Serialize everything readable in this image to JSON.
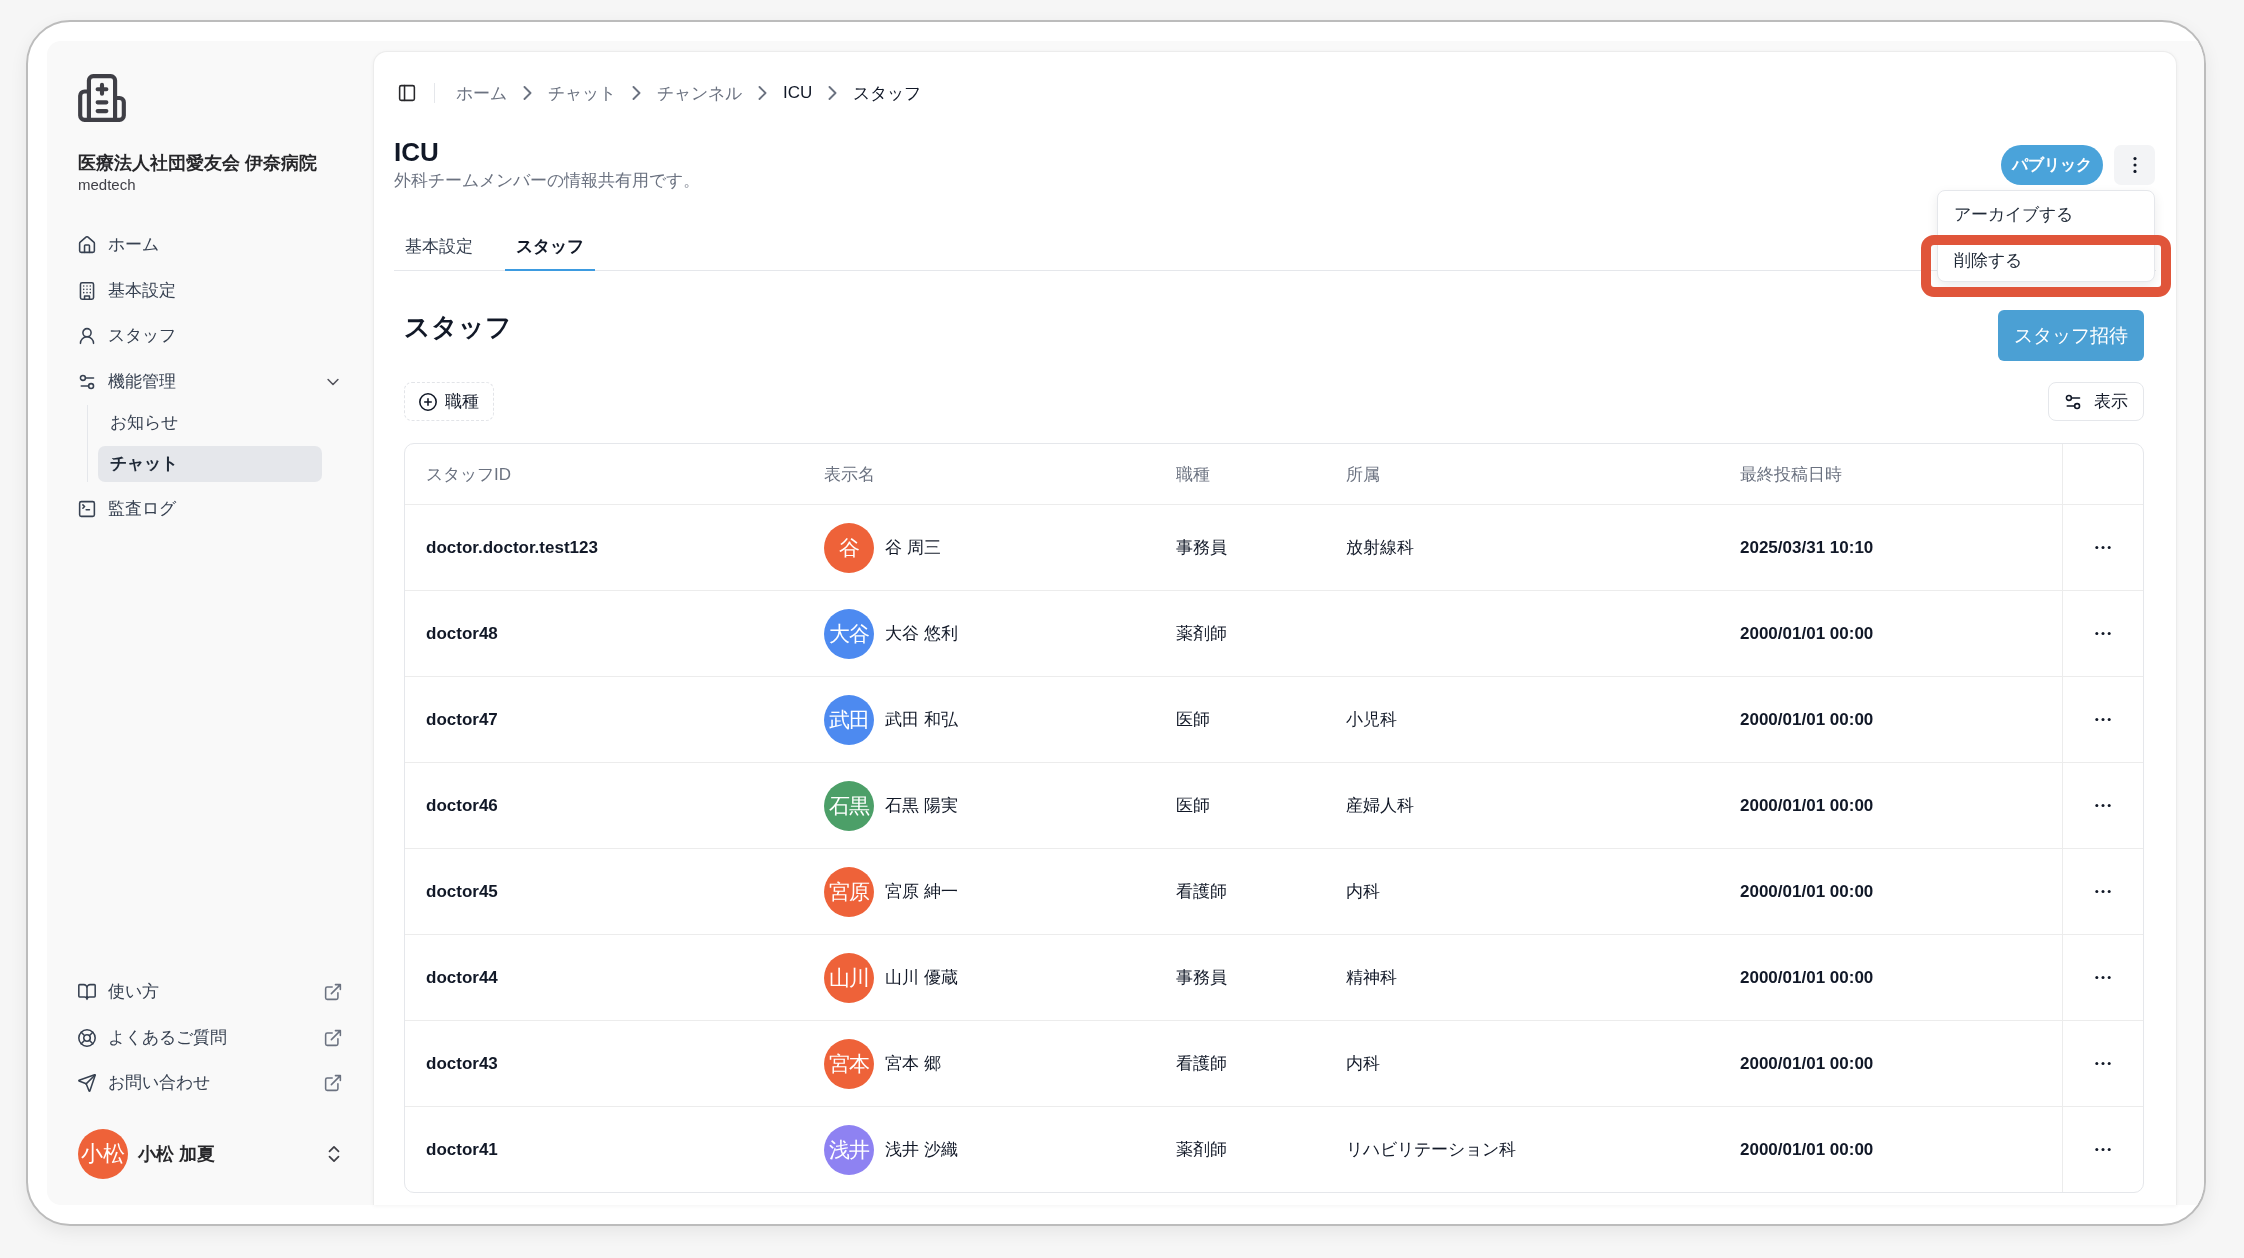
{
  "sidebar": {
    "organization": {
      "name": "医療法人社団愛友会 伊奈病院",
      "subtitle": "medtech"
    },
    "nav": [
      {
        "kind": "link",
        "label": "ホーム",
        "selected": false
      },
      {
        "kind": "link",
        "label": "基本設定",
        "selected": false
      },
      {
        "kind": "link",
        "label": "スタッフ",
        "selected": false
      },
      {
        "kind": "group",
        "label": "機能管理",
        "selected": false,
        "expanded": true,
        "children": [
          {
            "label": "お知らせ",
            "selected": false
          },
          {
            "label": "チャット",
            "selected": true
          }
        ]
      },
      {
        "kind": "link",
        "label": "監査ログ",
        "selected": false
      }
    ],
    "external_links": [
      {
        "label": "使い方"
      },
      {
        "label": "よくあるご質問"
      },
      {
        "label": "お問い合わせ"
      }
    ],
    "user": {
      "avatar": "小松",
      "name": "小松 加夏"
    }
  },
  "breadcrumb": [
    {
      "kind": "link",
      "label": "ホーム"
    },
    {
      "kind": "link",
      "label": "チャット"
    },
    {
      "kind": "link",
      "label": "チャンネル"
    },
    {
      "kind": "current",
      "label": "ICU"
    },
    {
      "kind": "current",
      "label": "スタッフ"
    }
  ],
  "header": {
    "title": "ICU",
    "description": "外科チームメンバーの情報共有用です。",
    "badge": "パブリック",
    "menu_open": true,
    "menu": [
      {
        "label": "アーカイブする",
        "highlighted": false
      },
      {
        "label": "削除する",
        "highlighted": true
      }
    ]
  },
  "tabs": [
    {
      "label": "基本設定",
      "selected": false
    },
    {
      "label": "スタッフ",
      "selected": true
    }
  ],
  "section": {
    "title": "スタッフ",
    "invite_button": "スタッフ招待",
    "filter_button": "職種",
    "view_button": "表示"
  },
  "table": {
    "columns": [
      "スタッフID",
      "表示名",
      "職種",
      "所属",
      "最終投稿日時"
    ],
    "rows": [
      {
        "staff_id": "doctor.doctor.test123",
        "avatar": "谷",
        "color": "#ee6239",
        "display_name": "谷 周三",
        "job": "事務員",
        "department": "放射線科",
        "last_posted": "2025/03/31 10:10"
      },
      {
        "staff_id": "doctor48",
        "avatar": "大谷",
        "color": "#4d8af0",
        "display_name": "大谷 悠利",
        "job": "薬剤師",
        "last_posted": "2000/01/01 00:00"
      },
      {
        "staff_id": "doctor47",
        "avatar": "武田",
        "color": "#4d8af0",
        "display_name": "武田 和弘",
        "job": "医師",
        "department": "小児科",
        "last_posted": "2000/01/01 00:00"
      },
      {
        "staff_id": "doctor46",
        "avatar": "石黒",
        "color": "#4c9f68",
        "display_name": "石黒 陽実",
        "job": "医師",
        "department": "産婦人科",
        "last_posted": "2000/01/01 00:00"
      },
      {
        "staff_id": "doctor45",
        "avatar": "宮原",
        "color": "#ee6239",
        "display_name": "宮原 紳一",
        "job": "看護師",
        "department": "内科",
        "last_posted": "2000/01/01 00:00"
      },
      {
        "staff_id": "doctor44",
        "avatar": "山川",
        "color": "#ee6239",
        "display_name": "山川 優蔵",
        "job": "事務員",
        "department": "精神科",
        "last_posted": "2000/01/01 00:00"
      },
      {
        "staff_id": "doctor43",
        "avatar": "宮本",
        "color": "#ee6239",
        "display_name": "宮本 郷",
        "job": "看護師",
        "department": "内科",
        "last_posted": "2000/01/01 00:00"
      },
      {
        "staff_id": "doctor41",
        "avatar": "浅井",
        "color": "#8e82f2",
        "display_name": "浅井 沙織",
        "job": "薬剤師",
        "department": "リハビリテーション科",
        "last_posted": "2000/01/01 00:00"
      }
    ]
  }
}
